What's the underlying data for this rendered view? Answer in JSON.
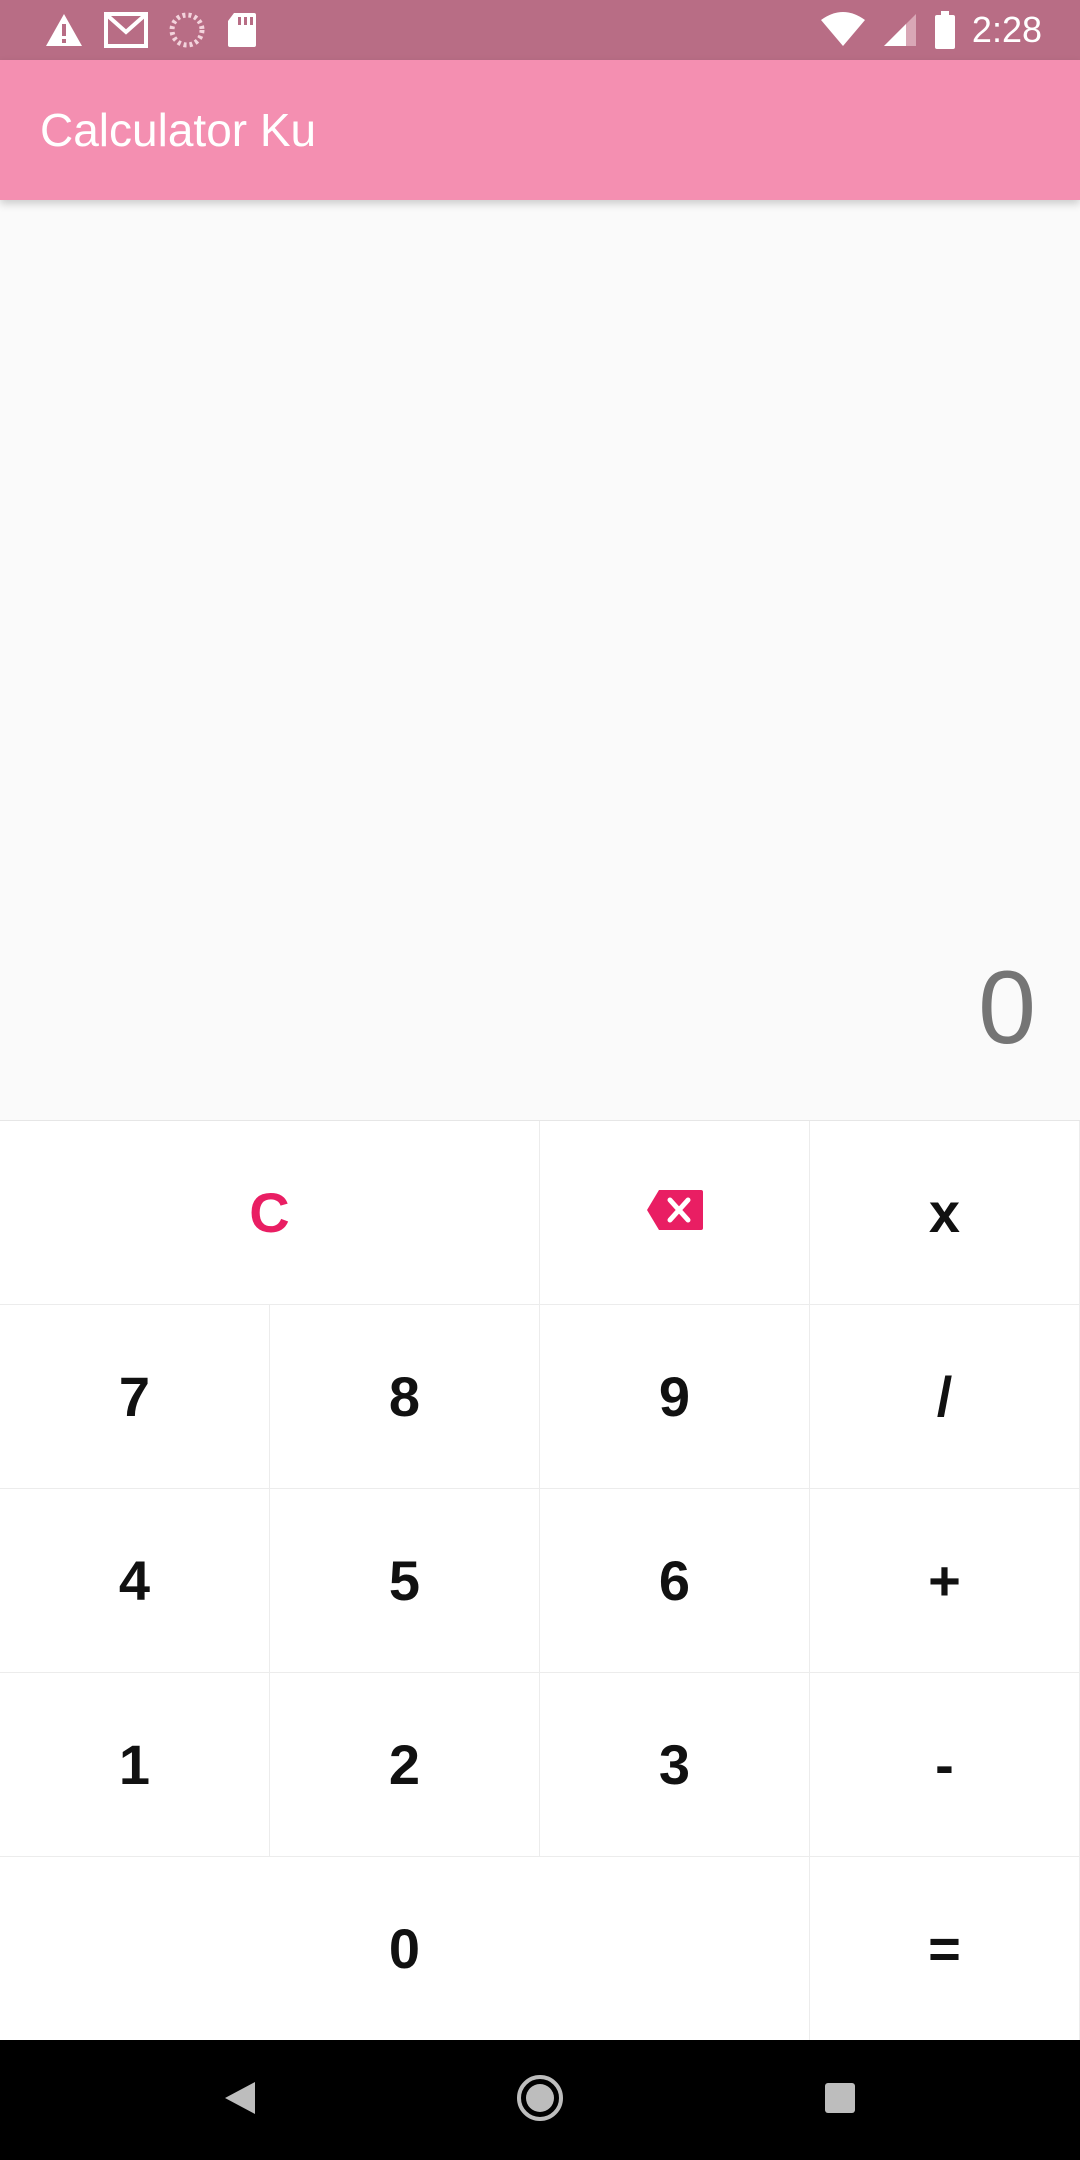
{
  "status_bar": {
    "time": "2:28",
    "icons_left": [
      "warning-icon",
      "gmail-icon",
      "loading-icon",
      "sd-card-icon"
    ],
    "icons_right": [
      "wifi-icon",
      "signal-icon",
      "battery-icon"
    ]
  },
  "app_bar": {
    "title": "Calculator Ku",
    "color": "#f48fb1"
  },
  "display": {
    "value": "0"
  },
  "keypad": {
    "clear": "C",
    "backspace_icon": "backspace-icon",
    "multiply": "x",
    "divide": "/",
    "add": "+",
    "subtract": "-",
    "equals": "=",
    "seven": "7",
    "eight": "8",
    "nine": "9",
    "four": "4",
    "five": "5",
    "six": "6",
    "one": "1",
    "two": "2",
    "three": "3",
    "zero": "0",
    "accent_color": "#e91e63"
  },
  "nav_bar": {
    "icons": [
      "back-icon",
      "home-icon",
      "recents-icon"
    ]
  }
}
